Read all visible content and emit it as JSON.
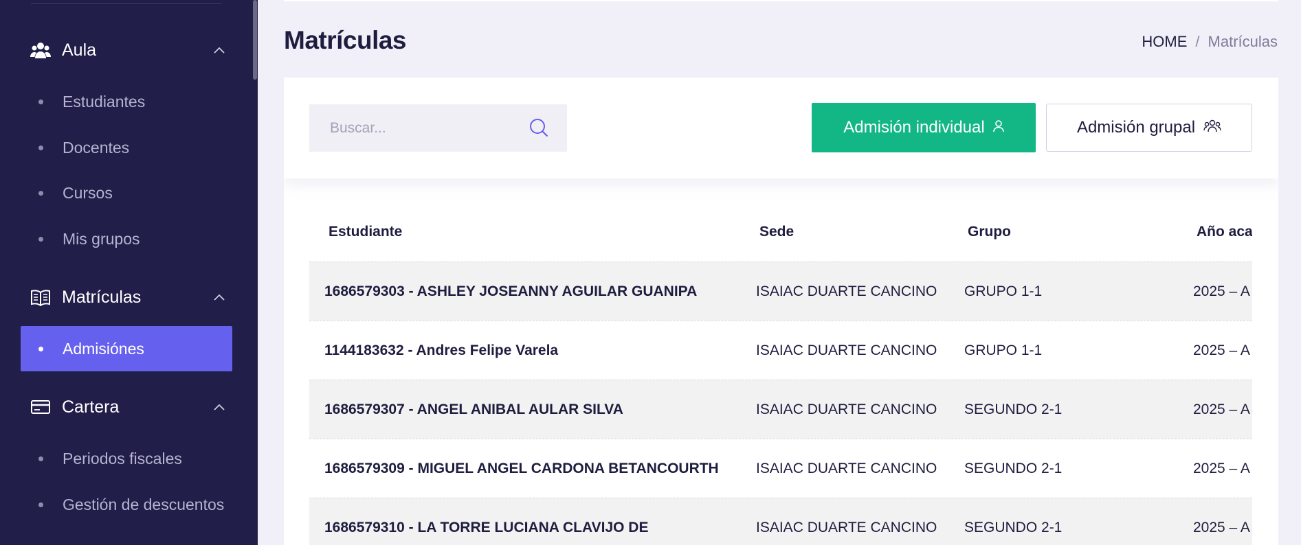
{
  "sidebar": {
    "sections": [
      {
        "label": "Aula",
        "icon": "users-group-icon"
      },
      {
        "label": "Matrículas",
        "icon": "open-book-icon"
      },
      {
        "label": "Cartera",
        "icon": "credit-card-icon"
      }
    ],
    "aula_items": [
      "Estudiantes",
      "Docentes",
      "Cursos",
      "Mis grupos"
    ],
    "matriculas_items": [
      "Admisiónes"
    ],
    "cartera_items": [
      "Periodos fiscales",
      "Gestión de descuentos"
    ],
    "active_item": "Admisiónes"
  },
  "header": {
    "title": "Matrículas",
    "breadcrumb": {
      "home": "HOME",
      "separator": "/",
      "current": "Matrículas"
    }
  },
  "toolbar": {
    "search_placeholder": "Buscar...",
    "individual_label": "Admisión individual",
    "group_label": "Admisión grupal"
  },
  "table": {
    "columns": [
      "Estudiante",
      "Sede",
      "Grupo",
      "Año aca"
    ],
    "rows": [
      [
        "1686579303 - ASHLEY JOSEANNY AGUILAR GUANIPA",
        "ISAIAC DUARTE CANCINO",
        "GRUPO 1-1",
        "2025 – A"
      ],
      [
        "1144183632 - Andres Felipe Varela",
        "ISAIAC DUARTE CANCINO",
        "GRUPO 1-1",
        "2025 – A"
      ],
      [
        "1686579307 - ANGEL ANIBAL AULAR SILVA",
        "ISAIAC DUARTE CANCINO",
        "SEGUNDO 2-1",
        "2025 – A"
      ],
      [
        "1686579309 - MIGUEL ANGEL CARDONA BETANCOURTH",
        "ISAIAC DUARTE CANCINO",
        "SEGUNDO 2-1",
        "2025 – A"
      ],
      [
        "1686579310 - LA TORRE LUCIANA CLAVIJO DE",
        "ISAIAC DUARTE CANCINO",
        "SEGUNDO 2-1",
        "2025 – A"
      ]
    ]
  },
  "colors": {
    "sidebar_bg": "#211f4a",
    "active_item_bg": "#6660ee",
    "primary_button": "#13b685",
    "page_bg": "#f1f0f8"
  }
}
